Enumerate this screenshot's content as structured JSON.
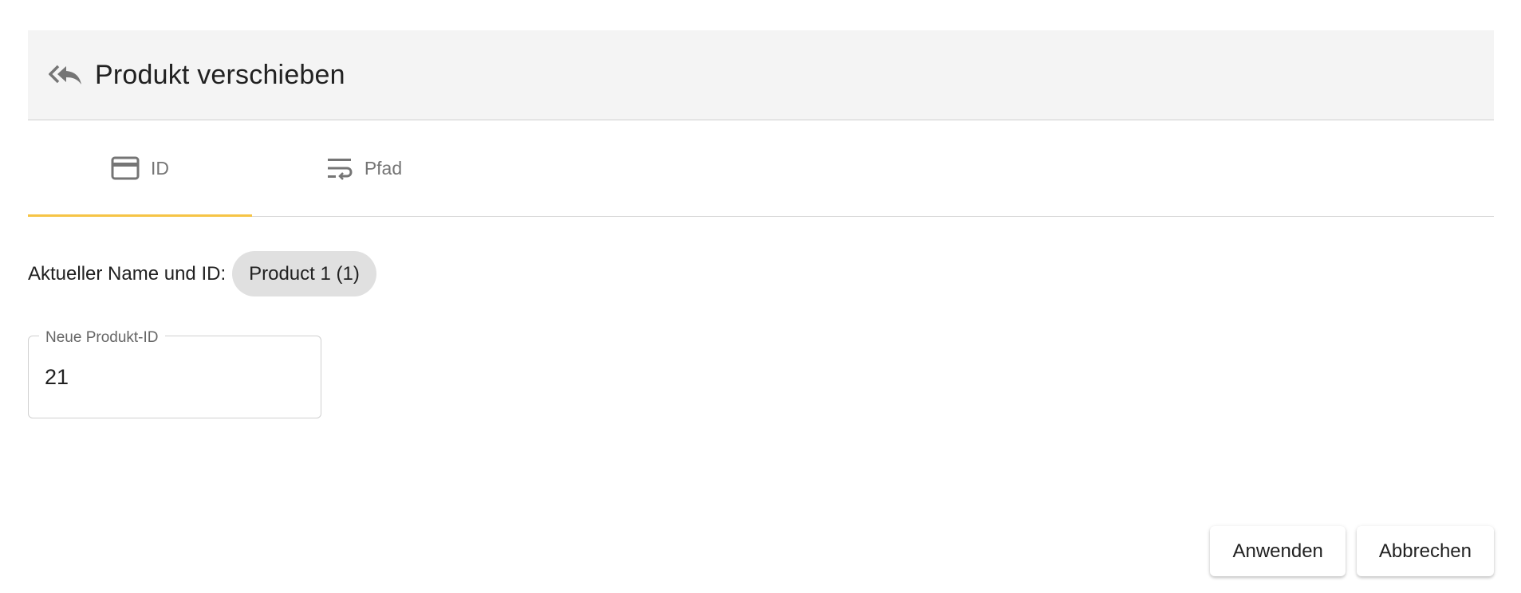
{
  "dialog": {
    "title": "Produkt verschieben",
    "title_icon": "reply-all-icon"
  },
  "tabs": [
    {
      "label": "ID",
      "icon": "credit-card-icon",
      "active": true
    },
    {
      "label": "Pfad",
      "icon": "wrap-text-icon",
      "active": false
    }
  ],
  "current": {
    "label": "Aktueller Name und ID:",
    "value": "Product 1 (1)"
  },
  "new_id_field": {
    "label": "Neue Produkt-ID",
    "value": "21"
  },
  "actions": {
    "apply_label": "Anwenden",
    "cancel_label": "Abbrechen"
  },
  "colors": {
    "header_bg": "#f4f4f4",
    "tab_indicator": "#f6c445",
    "chip_bg": "#e0e0e0",
    "icon_gray": "#757575"
  }
}
